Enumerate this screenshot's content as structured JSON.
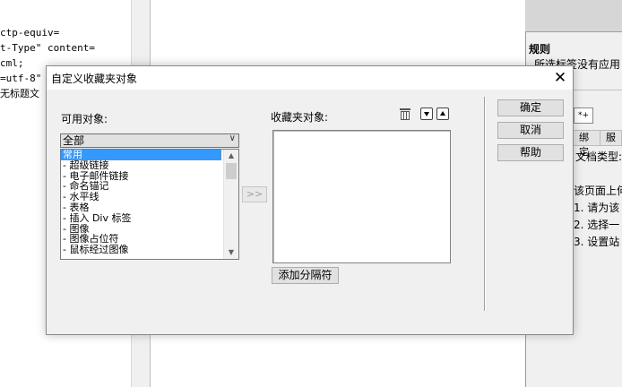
{
  "background": {
    "code_lines": [
      "ctp-equiv=",
      "t-Type\" content=",
      "cml;",
      "=utf-8\"",
      "无标题文"
    ],
    "rules_title": "规则",
    "rules_text": "所选标签没有应用",
    "toolbar_icon_text": "*+",
    "tabs": [
      "绑定",
      "服"
    ],
    "doctype_label": "文档类型:",
    "hint_lines": [
      "该页面上何",
      "1. 请为该",
      "2. 选择一",
      "3. 设置站"
    ]
  },
  "dialog": {
    "title": "自定义收藏夹对象",
    "close_glyph": "✕",
    "available_label": "可用对象:",
    "category_value": "全部",
    "available_items": [
      "常用",
      "- 超级链接",
      "- 电子邮件链接",
      "- 命名锚记",
      "- 水平线",
      "- 表格",
      "- 插入 Div 标签",
      "- 图像",
      "- 图像占位符",
      "- 鼠标经过图像"
    ],
    "selected_index": 0,
    "move_button_label": ">>",
    "favorites_label": "收藏夹对象:",
    "add_separator_label": "添加分隔符",
    "ok_label": "确定",
    "cancel_label": "取消",
    "help_label": "帮助"
  },
  "colors": {
    "selection": "#3399ff",
    "dialog_bg": "#f0f0f0",
    "button_bg": "#e1e1e1"
  }
}
